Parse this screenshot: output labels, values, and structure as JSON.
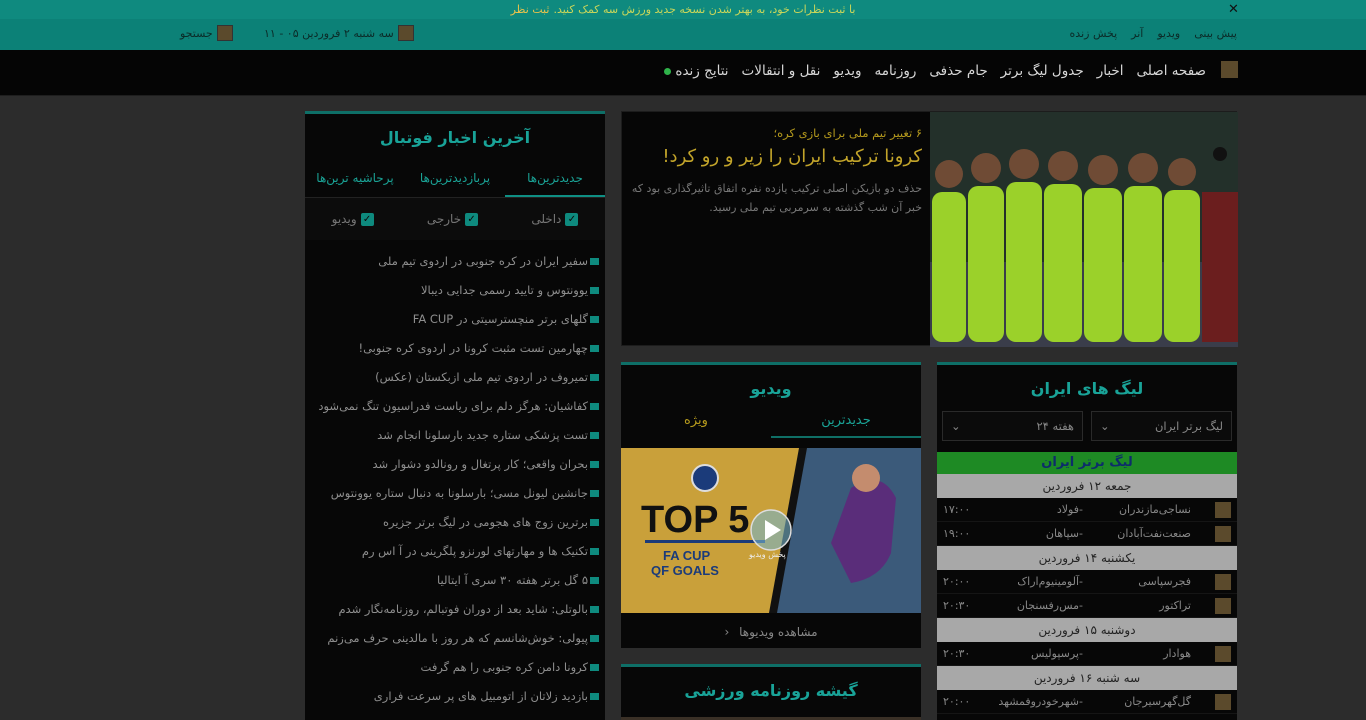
{
  "notice": {
    "text": "با ثبت نظرات خود، به بهتر شدن نسخه جدید ورزش سه کمک کنید.",
    "link": "ثبت نظر",
    "close": "✕"
  },
  "topbar": {
    "links": [
      "پیش بینی",
      "ویدیو",
      "آنر",
      "پخش زنده"
    ],
    "date": "سه شنبه ۲ فروردین ۰۵ - ۱۱",
    "search": "جستجو"
  },
  "nav": {
    "items": [
      "صفحه اصلی",
      "اخبار",
      "جدول لیگ برتر",
      "جام حذفی",
      "روزنامه",
      "ویدیو",
      "نقل و انتقالات"
    ],
    "live": "نتایج زنده"
  },
  "hero": {
    "kicker": "۶ تغییر تیم ملی برای بازی کره؛",
    "headline": "کرونا ترکیب ایران را زیر و رو کرد!",
    "lead": "حذف دو بازیکن اصلی ترکیب یازده نفره اتفاق تاثیرگذاری بود که خبر آن شب گذشته به سرمربی تیم ملی رسید."
  },
  "news": {
    "title": "آخرین اخبار فوتبال",
    "tabs": [
      "جدیدترین‌ها",
      "پربازدیدترین‌ها",
      "پرحاشیه ترین‌ها"
    ],
    "filters": [
      "داخلی",
      "خارجی",
      "ویدیو"
    ],
    "items": [
      "سفیر ایران در کره جنوبی در اردوی تیم ملی",
      "یوونتوس و تایید رسمی جدایی دیبالا",
      "گلهای برتر منچسترسیتی در FA CUP",
      "چهارمین تست مثبت کرونا در اردوی کره جنوبی!",
      "تمیروف در اردوی تیم ملی ازبکستان (عکس)",
      "کفاشیان: هرگز دلم برای ریاست فدراسیون تنگ نمی‌شود",
      "تست پزشکی ستاره جدید بارسلونا انجام شد",
      "بحران واقعی؛ کار پرتغال و رونالدو دشوار شد",
      "جانشین لیونل مسی؛ بارسلونا به دنبال ستاره یوونتوس",
      "برترین زوج های هجومی در لیگ برتر جزیره",
      "تکنیک ها و مهارتهای لورنزو پلگرینی در آ اس رم",
      "۵ گل برتر هفته ۳۰ سری آ ایتالیا",
      "بالوتلی: شاید بعد از دوران فوتبالم، روزنامه‌نگار شدم",
      "پیولی: خوش‌شانسم که هر روز با مالدینی حرف می‌زنم",
      "کرونا دامن کره جنوبی را هم گرفت",
      "بازدید زلاتان از اتومبیل های پر سرعت فراری"
    ],
    "video_items": [
      2,
      9,
      11
    ]
  },
  "video": {
    "title": "ویدیو",
    "tabs": [
      "جدیدترین",
      "ویژه"
    ],
    "thumb_big": "TOP 5",
    "thumb_sub1": "FA CUP",
    "thumb_sub2": "QF GOALS",
    "play_label": "پخش ویدیو",
    "more": "مشاهده ویدیوها"
  },
  "league": {
    "title": "لیگ های ایران",
    "select_league": "لیگ برتر ایران",
    "select_week": "هفته ۲۴",
    "banner": "لیگ برتر ایران",
    "days": [
      {
        "label": "جمعه ۱۲ فروردین",
        "matches": [
          {
            "home": "نساجی‌مازندران",
            "away": "فولاد",
            "time": "۱۷:۰۰"
          },
          {
            "home": "صنعت‌نفت‌آبادان",
            "away": "سپاهان",
            "time": "۱۹:۰۰"
          }
        ]
      },
      {
        "label": "یکشنبه ۱۴ فروردین",
        "matches": [
          {
            "home": "فجرسپاسی",
            "away": "آلومینیوم‌اراک",
            "time": "۲۰:۰۰"
          },
          {
            "home": "تراکتور",
            "away": "مس‌رفسنجان",
            "time": "۲۰:۳۰"
          }
        ]
      },
      {
        "label": "دوشنبه ۱۵ فروردین",
        "matches": [
          {
            "home": "هوادار",
            "away": "پرسپولیس",
            "time": "۲۰:۳۰"
          }
        ]
      },
      {
        "label": "سه شنبه ۱۶ فروردین",
        "matches": [
          {
            "home": "گل‌گهرسیرجان",
            "away": "شهرخودروفمشهد",
            "time": "۲۰:۰۰"
          }
        ]
      }
    ]
  },
  "press": {
    "title": "گیشه روزنامه ورزشی"
  },
  "colors": {
    "teal": "#0c8177",
    "accent": "#19a398",
    "gold": "#c2a42a",
    "green_bar": "#1e8a24"
  }
}
